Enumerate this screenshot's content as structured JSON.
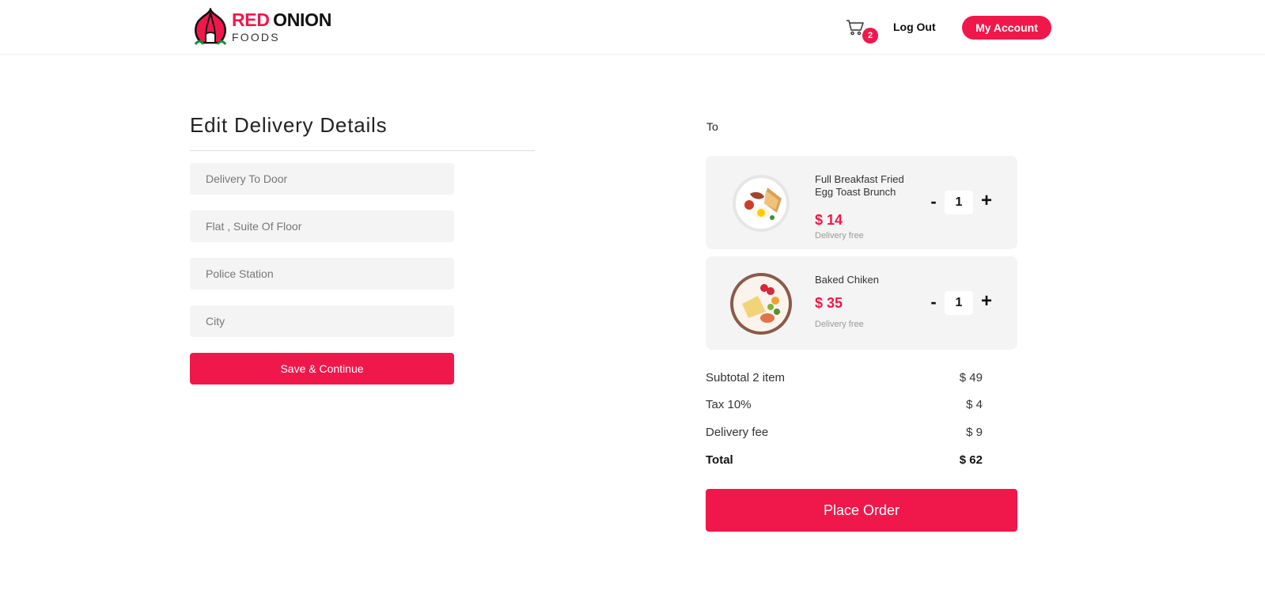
{
  "brand": {
    "name_red": "RED",
    "name_dark": "ONION",
    "sub": "FOODS",
    "accent": "#f0184a"
  },
  "header": {
    "cart_count": "2",
    "logout_label": "Log Out",
    "account_label": "My Account"
  },
  "delivery_form": {
    "title": "Edit Delivery Details",
    "fields": [
      {
        "placeholder": "Delivery To Door"
      },
      {
        "placeholder": "Flat , Suite Of Floor"
      },
      {
        "placeholder": "Police Station"
      },
      {
        "placeholder": "City"
      }
    ],
    "save_label": "Save & Continue"
  },
  "order": {
    "to_label": "To",
    "items": [
      {
        "name": "Full Breakfast Fried Egg Toast Brunch",
        "price": "$ 14",
        "delivery": "Delivery free",
        "qty": "1",
        "image_icon": "breakfast-plate-icon"
      },
      {
        "name": "Baked Chiken",
        "price": "$ 35",
        "delivery": "Delivery free",
        "qty": "1",
        "image_icon": "chicken-plate-icon"
      }
    ],
    "qty_minus": "-",
    "qty_plus": "+",
    "summary": [
      {
        "label": "Subtotal 2 item",
        "value": "$ 49"
      },
      {
        "label": "Tax 10%",
        "value": "$ 4"
      },
      {
        "label": "Delivery fee",
        "value": "$ 9"
      }
    ],
    "total": {
      "label": "Total",
      "value": "$ 62"
    },
    "place_order_label": "Place Order"
  }
}
